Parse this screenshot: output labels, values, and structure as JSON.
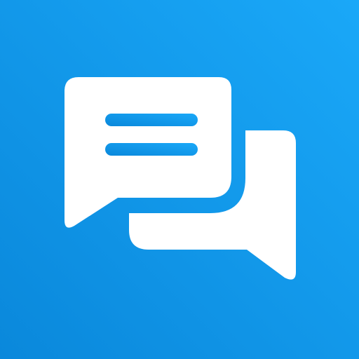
{
  "icon": {
    "name": "chat-bubbles-icon",
    "background_gradient": {
      "from": "#0A88DB",
      "to": "#1AA8F8"
    },
    "glyph_color": "#FFFFFF"
  }
}
